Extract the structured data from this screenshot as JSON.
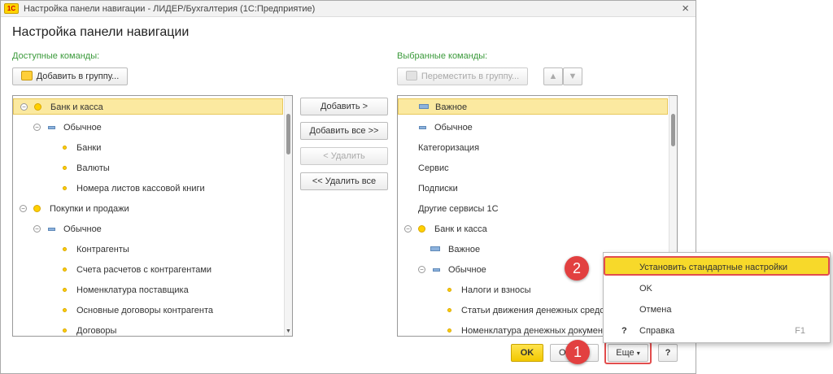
{
  "window": {
    "app_icon": "1c-logo-icon",
    "app_icon_text": "1С",
    "title": "Настройка панели навигации - ЛИДЕР/Бухгалтерия  (1С:Предприятие)",
    "close": "×"
  },
  "form": {
    "title": "Настройка панели навигации"
  },
  "available": {
    "label": "Доступные команды:",
    "add_to_group": "Добавить в группу...",
    "items": [
      {
        "text": "Банк и касса"
      },
      {
        "text": "Обычное"
      },
      {
        "text": "Банки"
      },
      {
        "text": "Валюты"
      },
      {
        "text": "Номера листов кассовой книги"
      },
      {
        "text": "Покупки и продажи"
      },
      {
        "text": "Обычное"
      },
      {
        "text": "Контрагенты"
      },
      {
        "text": "Счета расчетов с контрагентами"
      },
      {
        "text": "Номенклатура поставщика"
      },
      {
        "text": "Основные договоры контрагента"
      },
      {
        "text": "Договоры"
      }
    ]
  },
  "middle": {
    "add": "Добавить >",
    "add_all": "Добавить все >>",
    "remove": "< Удалить",
    "remove_all": "<< Удалить все"
  },
  "selected": {
    "label": "Выбранные команды:",
    "move_to_group": "Переместить в группу...",
    "items": [
      {
        "text": "Важное"
      },
      {
        "text": "Обычное"
      },
      {
        "text": "Категоризация"
      },
      {
        "text": "Сервис"
      },
      {
        "text": "Подписки"
      },
      {
        "text": "Другие сервисы 1С"
      },
      {
        "text": "Банк и касса"
      },
      {
        "text": "Важное"
      },
      {
        "text": "Обычное"
      },
      {
        "text": "Налоги и взносы"
      },
      {
        "text": "Статьи движения денежных средс"
      },
      {
        "text": "Номенклатура денежных документ"
      }
    ]
  },
  "footer": {
    "ok": "OK",
    "cancel_partial": "О",
    "more": "Еще",
    "help": "?"
  },
  "menu": {
    "items": [
      {
        "text": "Установить стандартные настройки",
        "shortcut": ""
      },
      {
        "text": "OK",
        "shortcut": ""
      },
      {
        "text": "Отмена",
        "shortcut": ""
      },
      {
        "text": "Справка",
        "shortcut": "F1",
        "icon": "?"
      }
    ]
  },
  "annotations": {
    "badge1": "1",
    "badge2": "2",
    "highlight_color": "#e24d4d"
  },
  "colors": {
    "accent": "#ffd400",
    "selection": "#fbe9a0",
    "group_label": "#3b9a3b"
  }
}
